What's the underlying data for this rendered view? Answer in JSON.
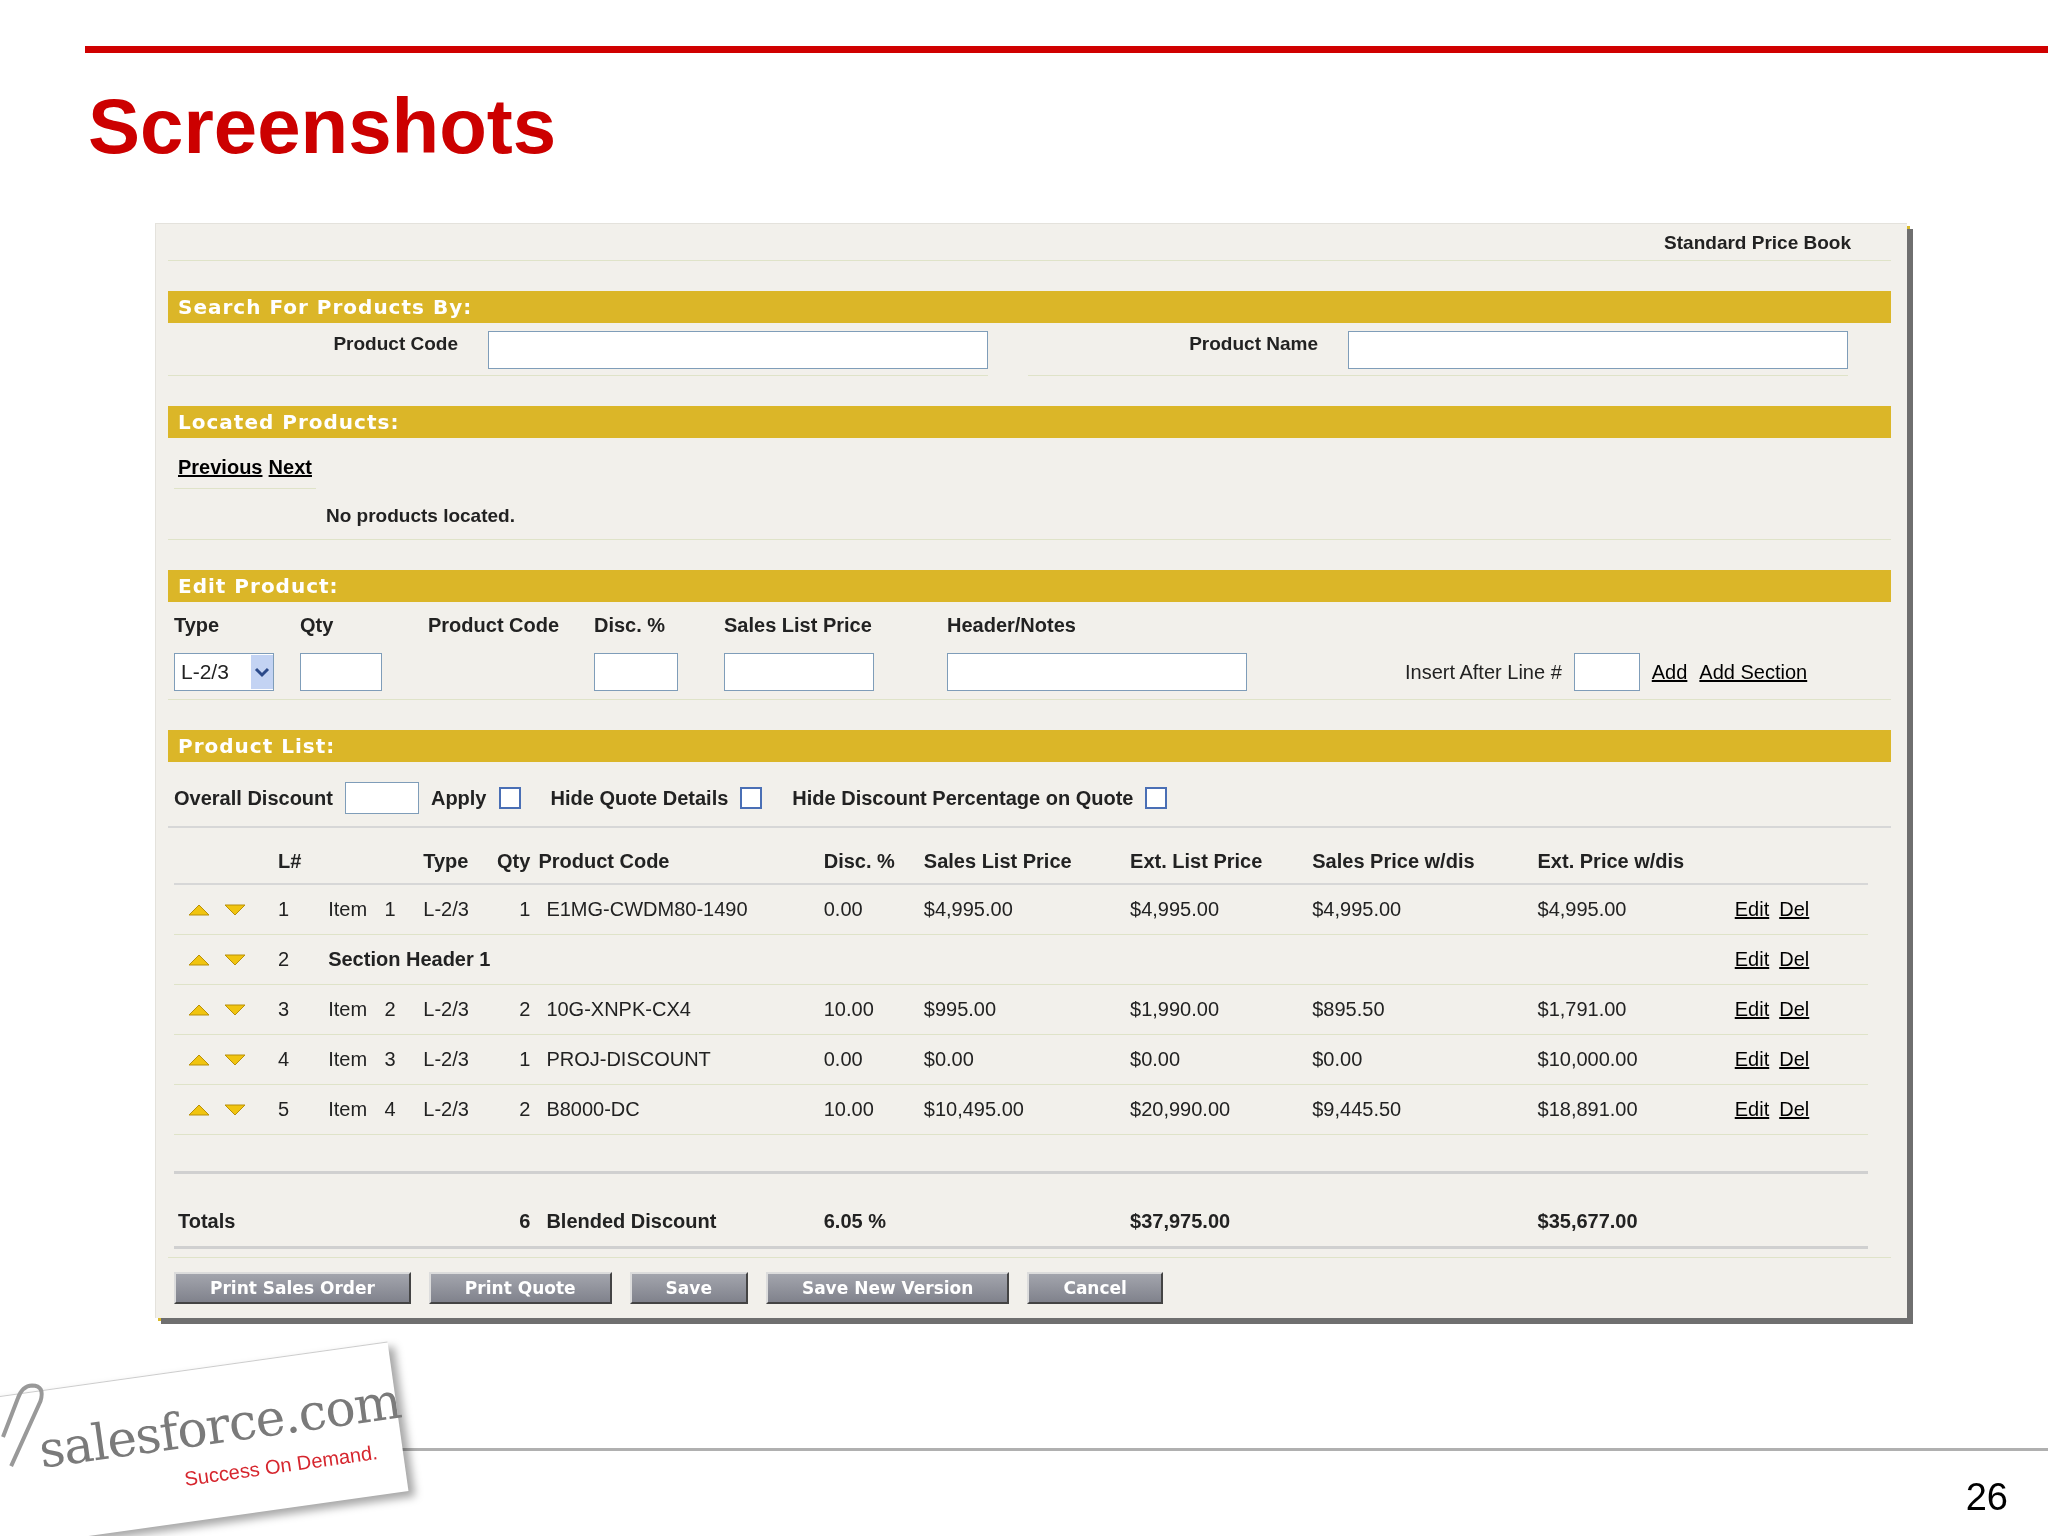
{
  "slide": {
    "title": "Screenshots",
    "page_number": "26"
  },
  "price_book": "Standard Price Book",
  "search": {
    "heading": "Search For Products By:",
    "fields": [
      {
        "label": "Product Code"
      },
      {
        "label": "Product Name"
      }
    ]
  },
  "located": {
    "heading": "Located Products:",
    "links": [
      "Previous",
      "Next"
    ],
    "message": "No products located."
  },
  "edit": {
    "heading": "Edit Product:",
    "columns": [
      "Type",
      "Qty",
      "Product Code",
      "Disc. %",
      "Sales List Price",
      "Header/Notes"
    ],
    "type_value": "L-2/3",
    "insert_label": "Insert After Line #",
    "links": [
      "Add",
      "Add Section"
    ]
  },
  "product_list": {
    "heading": "Product List:",
    "overall_discount": "Overall Discount",
    "options": [
      {
        "label": "Apply",
        "checked": false
      },
      {
        "label": "Hide Quote Details",
        "checked": false
      },
      {
        "label": "Hide Discount Percentage on Quote",
        "checked": false
      }
    ],
    "columns": [
      "L#",
      "Type",
      "Qty",
      "Product Code",
      "Disc. %",
      "Sales List Price",
      "Ext. List Price",
      "Sales Price w/dis",
      "Ext. Price w/dis"
    ],
    "rows": [
      {
        "kind": "item",
        "line": "1",
        "item": "Item 1",
        "type": "L-2/3",
        "qty": "1",
        "code": "E1MG-CWDM80-1490",
        "disc": "0.00",
        "sales_list": "$4,995.00",
        "ext_list": "$4,995.00",
        "sales_dis": "$4,995.00",
        "ext_dis": "$4,995.00",
        "actions": [
          "Edit",
          "Del"
        ]
      },
      {
        "kind": "section",
        "line": "2",
        "item": "Section Header 1",
        "actions": [
          "Edit",
          "Del"
        ]
      },
      {
        "kind": "item",
        "line": "3",
        "item": "Item 2",
        "type": "L-2/3",
        "qty": "2",
        "code": "10G-XNPK-CX4",
        "disc": "10.00",
        "sales_list": "$995.00",
        "ext_list": "$1,990.00",
        "sales_dis": "$895.50",
        "ext_dis": "$1,791.00",
        "actions": [
          "Edit",
          "Del"
        ]
      },
      {
        "kind": "item",
        "line": "4",
        "item": "Item 3",
        "type": "L-2/3",
        "qty": "1",
        "code": "PROJ-DISCOUNT",
        "disc": "0.00",
        "sales_list": "$0.00",
        "ext_list": "$0.00",
        "sales_dis": "$0.00",
        "ext_dis": "$10,000.00",
        "actions": [
          "Edit",
          "Del"
        ]
      },
      {
        "kind": "item",
        "line": "5",
        "item": "Item 4",
        "type": "L-2/3",
        "qty": "2",
        "code": "B8000-DC",
        "disc": "10.00",
        "sales_list": "$10,495.00",
        "ext_list": "$20,990.00",
        "sales_dis": "$9,445.50",
        "ext_dis": "$18,891.00",
        "actions": [
          "Edit",
          "Del"
        ]
      }
    ],
    "totals": {
      "label": "Totals",
      "qty": "6",
      "discount_label": "Blended Discount",
      "discount": "6.05 %",
      "ext_list": "$37,975.00",
      "ext_dis": "$35,677.00"
    }
  },
  "buttons": [
    "Print Sales Order",
    "Print Quote",
    "Save",
    "Save New Version",
    "Cancel"
  ],
  "logo": {
    "name": "salesforce.com",
    "tagline": "Success On Demand."
  }
}
